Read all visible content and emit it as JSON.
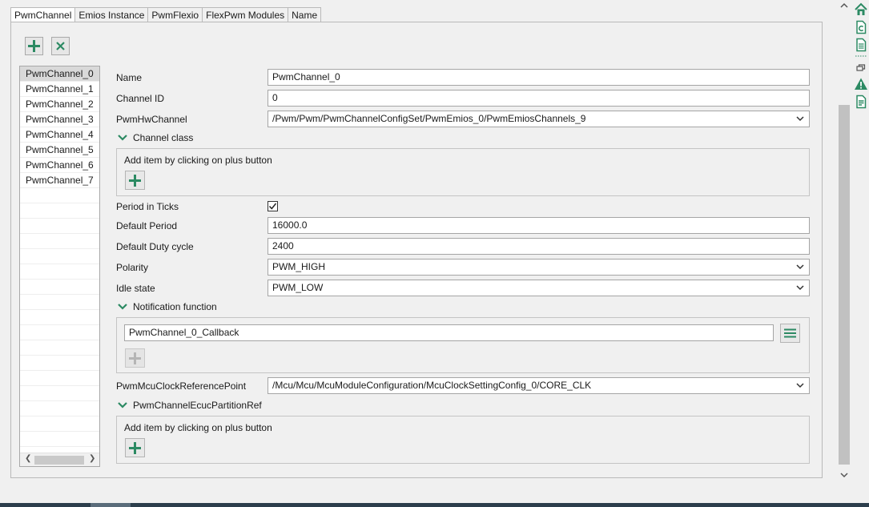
{
  "tabs": [
    {
      "label": "PwmChannel",
      "active": true
    },
    {
      "label": "Emios Instance",
      "active": false
    },
    {
      "label": "PwmFlexio",
      "active": false
    },
    {
      "label": "FlexPwm Modules",
      "active": false
    },
    {
      "label": "Name",
      "active": false
    }
  ],
  "toolbar": {
    "add_icon": "plus-icon",
    "remove_icon": "close-icon"
  },
  "channels": {
    "items": [
      "PwmChannel_0",
      "PwmChannel_1",
      "PwmChannel_2",
      "PwmChannel_3",
      "PwmChannel_4",
      "PwmChannel_5",
      "PwmChannel_6",
      "PwmChannel_7"
    ],
    "selected": "PwmChannel_0"
  },
  "form": {
    "name": {
      "label": "Name",
      "value": "PwmChannel_0"
    },
    "channel_id": {
      "label": "Channel ID",
      "value": "0"
    },
    "hw_channel": {
      "label": "PwmHwChannel",
      "value": "/Pwm/Pwm/PwmChannelConfigSet/PwmEmios_0/PwmEmiosChannels_9"
    },
    "channel_class": {
      "title": "Channel class",
      "hint": "Add item by clicking on plus button"
    },
    "period_in_ticks": {
      "label": "Period in Ticks",
      "checked": true
    },
    "default_period": {
      "label": "Default Period",
      "value": "16000.0"
    },
    "default_duty": {
      "label": "Default Duty cycle",
      "value": "2400"
    },
    "polarity": {
      "label": "Polarity",
      "value": "PWM_HIGH"
    },
    "idle_state": {
      "label": "Idle state",
      "value": "PWM_LOW"
    },
    "notification": {
      "title": "Notification function",
      "value": "PwmChannel_0_Callback"
    },
    "mcu_clock": {
      "label": "PwmMcuClockReferencePoint",
      "value": "/Mcu/Mcu/McuModuleConfiguration/McuClockSettingConfig_0/CORE_CLK"
    },
    "ecuc_partition": {
      "title": "PwmChannelEcucPartitionRef",
      "hint": "Add item by clicking on plus button"
    }
  },
  "side_icons": [
    "home-icon",
    "c-file-icon",
    "document-icon",
    "restore-icon",
    "warning-icon",
    "report-icon"
  ],
  "colors": {
    "accent": "#2c8a63",
    "selection": "#d9d9d9",
    "taskbar": "#2c3e4c"
  }
}
